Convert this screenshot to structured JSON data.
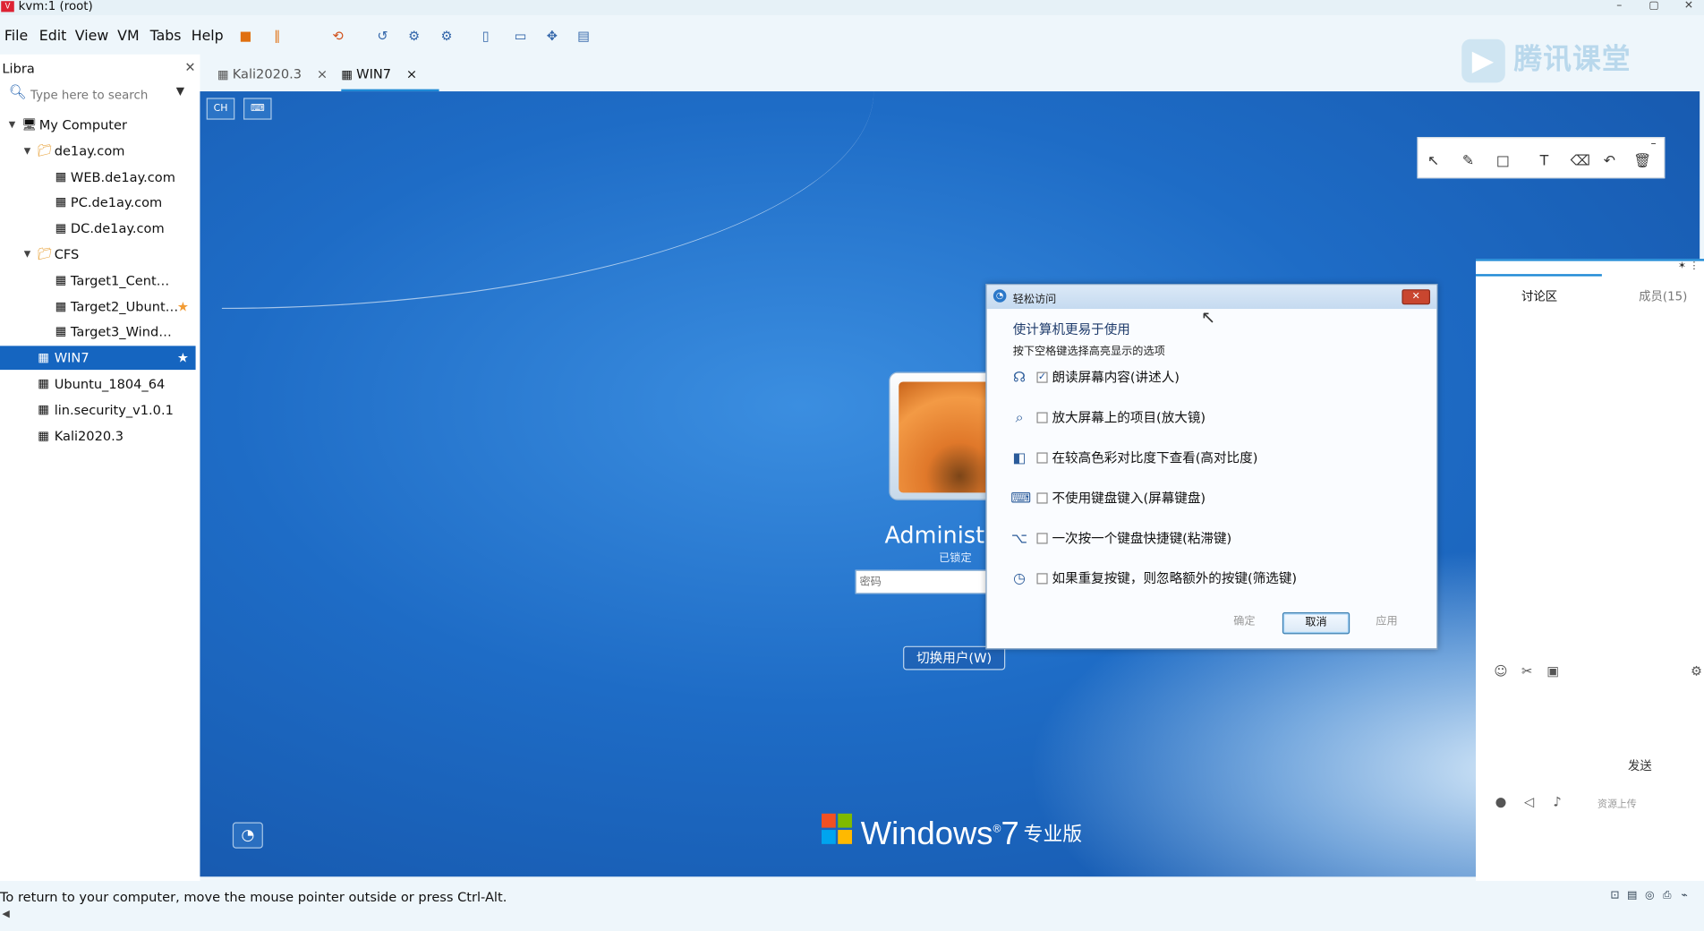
{
  "window": {
    "title": "kvm:1 (root)",
    "app_icon": "vmware-icon"
  },
  "menu": [
    "File",
    "Edit",
    "View",
    "VM",
    "Tabs",
    "Help"
  ],
  "toolbar_icons": [
    "power-icon",
    "pause-icon",
    "snapshot-icon",
    "revert-icon",
    "manage-snapshots-icon",
    "settings-icon",
    "console-icon",
    "fullscreen-icon",
    "unity-icon",
    "stretch-icon"
  ],
  "watermark": "腾讯课堂",
  "library": {
    "title": "Libra",
    "search_placeholder": "Type here to search",
    "tree": [
      {
        "label": "My Computer",
        "level": 0,
        "icon": "computer-icon",
        "expanded": true
      },
      {
        "label": "de1ay.com",
        "level": 1,
        "icon": "folder-icon",
        "expanded": true
      },
      {
        "label": "WEB.de1ay.com",
        "level": 2,
        "icon": "vm-icon"
      },
      {
        "label": "PC.de1ay.com",
        "level": 2,
        "icon": "vm-icon"
      },
      {
        "label": "DC.de1ay.com",
        "level": 2,
        "icon": "vm-icon"
      },
      {
        "label": "CFS",
        "level": 1,
        "icon": "folder-icon",
        "expanded": true
      },
      {
        "label": "Target1_Cent…",
        "level": 2,
        "icon": "vm-icon"
      },
      {
        "label": "Target2_Ubunt…",
        "level": 2,
        "icon": "vm-icon",
        "starred": true
      },
      {
        "label": "Target3_Wind…",
        "level": 2,
        "icon": "vm-icon"
      },
      {
        "label": "WIN7",
        "level": 1,
        "icon": "vm-icon",
        "selected": true,
        "starred": true
      },
      {
        "label": "Ubuntu_1804_64",
        "level": 1,
        "icon": "vm-icon"
      },
      {
        "label": "lin.security_v1.0.1",
        "level": 1,
        "icon": "vm-icon"
      },
      {
        "label": "Kali2020.3",
        "level": 1,
        "icon": "vm-icon"
      }
    ]
  },
  "tabs": [
    {
      "label": "Kali2020.3",
      "active": false
    },
    {
      "label": "WIN7",
      "active": true
    }
  ],
  "vm": {
    "mini_buttons": [
      "CH",
      "⌨"
    ],
    "username": "Administra",
    "locked": "已锁定",
    "password_placeholder": "密码",
    "switch_user": "切换用户(W)",
    "os_name": "Windows",
    "os_version": "7",
    "edition": "专业版"
  },
  "dialog": {
    "title": "轻松访问",
    "heading": "使计算机更易于使用",
    "subheading": "按下空格键选择高亮显示的选项",
    "options": [
      {
        "label": "朗读屏幕内容(讲述人)",
        "checked": true,
        "icon": "narrator-icon"
      },
      {
        "label": "放大屏幕上的项目(放大镜)",
        "checked": false,
        "icon": "magnifier-icon"
      },
      {
        "label": "在较高色彩对比度下查看(高对比度)",
        "checked": false,
        "icon": "high-contrast-icon"
      },
      {
        "label": "不使用键盘键入(屏幕键盘)",
        "checked": false,
        "icon": "keyboard-icon"
      },
      {
        "label": "一次按一个键盘快捷键(粘滞键)",
        "checked": false,
        "icon": "sticky-keys-icon"
      },
      {
        "label": "如果重复按键，则忽略额外的按键(筛选键)",
        "checked": false,
        "icon": "filter-keys-icon"
      }
    ],
    "ok": "确定",
    "cancel": "取消",
    "apply": "应用"
  },
  "annotation_tools": [
    "select-icon",
    "pen-icon",
    "rectangle-icon",
    "text-icon",
    "eraser-icon",
    "undo-icon",
    "delete-icon"
  ],
  "discussion": {
    "tab_discussion": "讨论区",
    "tab_members": "成员(15)",
    "send": "发送",
    "resource": "资源上传"
  },
  "status": {
    "text": "To return to your computer, move the mouse pointer outside or press Ctrl-Alt."
  },
  "colors": {
    "accent": "#1565c0",
    "desktop": "#1e6cc6",
    "star": "#f29b33"
  }
}
